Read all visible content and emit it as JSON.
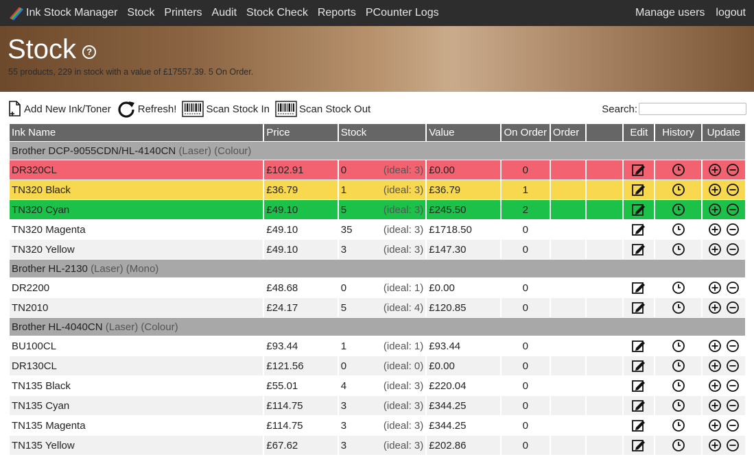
{
  "nav": {
    "brand": "Ink Stock Manager",
    "items": [
      "Stock",
      "Printers",
      "Audit",
      "Stock Check",
      "Reports",
      "PCounter Logs"
    ],
    "right": [
      "Manage users",
      "logout"
    ]
  },
  "header": {
    "title": "Stock",
    "summary": "55 products, 229 in stock with a value of £17557.39. 5 On Order."
  },
  "toolbar": {
    "add_label": "Add New Ink/Toner",
    "refresh_label": "Refresh!",
    "scan_in_label": "Scan Stock In",
    "scan_out_label": "Scan Stock Out",
    "search_label": "Search:",
    "search_value": ""
  },
  "table": {
    "columns": [
      "Ink Name",
      "Price",
      "Stock",
      "Value",
      "On Order",
      "Order",
      "",
      "Edit",
      "History",
      "Update"
    ],
    "groups": [
      {
        "printer": "Brother DCP-9055CDN/HL-4140CN",
        "type": "(Laser)",
        "color": "(Colour)",
        "rows": [
          {
            "name": "DR320CL",
            "price": "£102.91",
            "stock": "0",
            "ideal": "(ideal: 3)",
            "value": "£0.00",
            "on_order": "0",
            "status": "red"
          },
          {
            "name": "TN320 Black",
            "price": "£36.79",
            "stock": "1",
            "ideal": "(ideal: 3)",
            "value": "£36.79",
            "on_order": "1",
            "status": "yellow"
          },
          {
            "name": "TN320 Cyan",
            "price": "£49.10",
            "stock": "5",
            "ideal": "(ideal: 3)",
            "value": "£245.50",
            "on_order": "2",
            "status": "green"
          },
          {
            "name": "TN320 Magenta",
            "price": "£49.10",
            "stock": "35",
            "ideal": "(ideal: 3)",
            "value": "£1718.50",
            "on_order": "0",
            "status": "white"
          },
          {
            "name": "TN320 Yellow",
            "price": "£49.10",
            "stock": "3",
            "ideal": "(ideal: 3)",
            "value": "£147.30",
            "on_order": "0",
            "status": "grey"
          }
        ]
      },
      {
        "printer": "Brother HL-2130",
        "type": "(Laser)",
        "color": "(Mono)",
        "rows": [
          {
            "name": "DR2200",
            "price": "£48.68",
            "stock": "0",
            "ideal": "(ideal: 1)",
            "value": "£0.00",
            "on_order": "0",
            "status": "white"
          },
          {
            "name": "TN2010",
            "price": "£24.17",
            "stock": "5",
            "ideal": "(ideal: 4)",
            "value": "£120.85",
            "on_order": "0",
            "status": "grey"
          }
        ]
      },
      {
        "printer": "Brother HL-4040CN",
        "type": "(Laser)",
        "color": "(Colour)",
        "rows": [
          {
            "name": "BU100CL",
            "price": "£93.44",
            "stock": "1",
            "ideal": "(ideal: 1)",
            "value": "£93.44",
            "on_order": "0",
            "status": "white"
          },
          {
            "name": "DR130CL",
            "price": "£121.56",
            "stock": "0",
            "ideal": "(ideal: 0)",
            "value": "£0.00",
            "on_order": "0",
            "status": "grey"
          },
          {
            "name": "TN135 Black",
            "price": "£55.01",
            "stock": "4",
            "ideal": "(ideal: 3)",
            "value": "£220.04",
            "on_order": "0",
            "status": "white"
          },
          {
            "name": "TN135 Cyan",
            "price": "£114.75",
            "stock": "3",
            "ideal": "(ideal: 3)",
            "value": "£344.25",
            "on_order": "0",
            "status": "grey"
          },
          {
            "name": "TN135 Magenta",
            "price": "£114.75",
            "stock": "3",
            "ideal": "(ideal: 3)",
            "value": "£344.25",
            "on_order": "0",
            "status": "white"
          },
          {
            "name": "TN135 Yellow",
            "price": "£67.62",
            "stock": "3",
            "ideal": "(ideal: 3)",
            "value": "£202.86",
            "on_order": "0",
            "status": "grey"
          }
        ]
      }
    ]
  },
  "colors": {
    "navbar": "#2d2d2d",
    "header_row": "#666666",
    "group_row": "#a8a8a8",
    "status_red": "#f26270",
    "status_yellow": "#f7d84e",
    "status_green": "#1cc14a"
  },
  "icons": {
    "add": "add-document-icon",
    "refresh": "refresh-icon",
    "scan": "barcode-icon",
    "edit": "edit-icon",
    "history": "clock-icon",
    "plus": "plus-circle-icon",
    "minus": "minus-circle-icon"
  }
}
